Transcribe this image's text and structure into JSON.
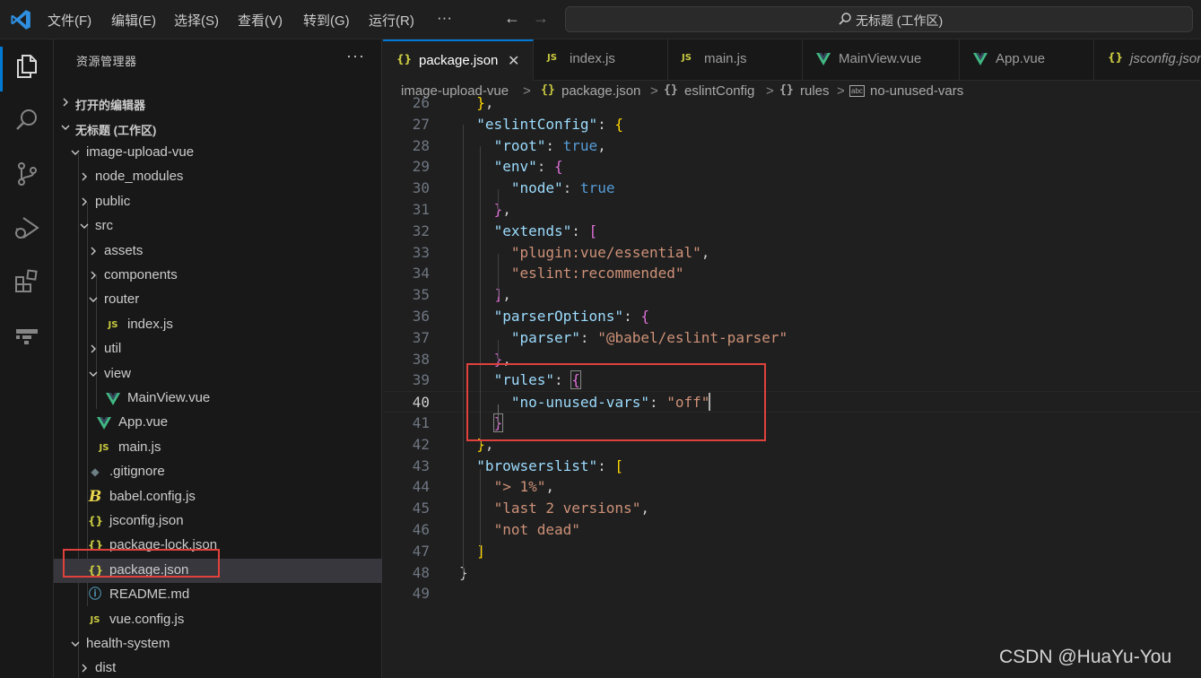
{
  "menu": {
    "items": [
      "文件(F)",
      "编辑(E)",
      "选择(S)",
      "查看(V)",
      "转到(G)",
      "运行(R)"
    ],
    "more": "···"
  },
  "navigation": {
    "back": "←",
    "forward": "→"
  },
  "command_center": {
    "label": "无标题 (工作区)"
  },
  "explorer": {
    "title": "资源管理器",
    "more": "···",
    "open_editors": "打开的编辑器",
    "workspace": "无标题 (工作区)",
    "tree": [
      {
        "label": "image-upload-vue",
        "kind": "folder-open"
      },
      {
        "label": "node_modules",
        "kind": "folder"
      },
      {
        "label": "public",
        "kind": "folder"
      },
      {
        "label": "src",
        "kind": "folder-open"
      },
      {
        "label": "assets",
        "kind": "folder"
      },
      {
        "label": "components",
        "kind": "folder"
      },
      {
        "label": "router",
        "kind": "folder-open"
      },
      {
        "label": "index.js",
        "kind": "js"
      },
      {
        "label": "util",
        "kind": "folder"
      },
      {
        "label": "view",
        "kind": "folder-open"
      },
      {
        "label": "MainView.vue",
        "kind": "vue"
      },
      {
        "label": "App.vue",
        "kind": "vue"
      },
      {
        "label": "main.js",
        "kind": "js"
      },
      {
        "label": ".gitignore",
        "kind": "git"
      },
      {
        "label": "babel.config.js",
        "kind": "babel"
      },
      {
        "label": "jsconfig.json",
        "kind": "json"
      },
      {
        "label": "package-lock.json",
        "kind": "json"
      },
      {
        "label": "package.json",
        "kind": "json"
      },
      {
        "label": "README.md",
        "kind": "info"
      },
      {
        "label": "vue.config.js",
        "kind": "js"
      },
      {
        "label": "health-system",
        "kind": "folder-open"
      },
      {
        "label": "dist",
        "kind": "folder"
      }
    ]
  },
  "icons": {
    "js": "JS",
    "json": "{}",
    "git": "◆",
    "babel": "B",
    "info": "ⓘ",
    "breadcrumb_braces": "{}",
    "breadcrumb_string": "abc"
  },
  "tabs": [
    {
      "label": "package.json",
      "kind": "json",
      "active": true,
      "close": "✕"
    },
    {
      "label": "index.js",
      "kind": "js"
    },
    {
      "label": "main.js",
      "kind": "js"
    },
    {
      "label": "MainView.vue",
      "kind": "vue"
    },
    {
      "label": "App.vue",
      "kind": "vue"
    },
    {
      "label": "jsconfig.json",
      "kind": "json"
    }
  ],
  "breadcrumbs": [
    "image-upload-vue",
    "package.json",
    "eslintConfig",
    "rules",
    "no-unused-vars"
  ],
  "breadcrumb_sep": ">",
  "editor": {
    "lines": [
      {
        "n": "26",
        "code": "  },"
      },
      {
        "n": "27",
        "code": "  \"eslintConfig\": {"
      },
      {
        "n": "28",
        "code": "    \"root\": true,"
      },
      {
        "n": "29",
        "code": "    \"env\": {"
      },
      {
        "n": "30",
        "code": "      \"node\": true"
      },
      {
        "n": "31",
        "code": "    },"
      },
      {
        "n": "32",
        "code": "    \"extends\": ["
      },
      {
        "n": "33",
        "code": "      \"plugin:vue/essential\","
      },
      {
        "n": "34",
        "code": "      \"eslint:recommended\""
      },
      {
        "n": "35",
        "code": "    ],"
      },
      {
        "n": "36",
        "code": "    \"parserOptions\": {"
      },
      {
        "n": "37",
        "code": "      \"parser\": \"@babel/eslint-parser\""
      },
      {
        "n": "38",
        "code": "    },"
      },
      {
        "n": "39",
        "code": "    \"rules\": {"
      },
      {
        "n": "40",
        "code": "      \"no-unused-vars\": \"off\""
      },
      {
        "n": "41",
        "code": "    }"
      },
      {
        "n": "42",
        "code": "  },"
      },
      {
        "n": "43",
        "code": "  \"browserslist\": ["
      },
      {
        "n": "44",
        "code": "    \"> 1%\","
      },
      {
        "n": "45",
        "code": "    \"last 2 versions\","
      },
      {
        "n": "46",
        "code": "    \"not dead\""
      },
      {
        "n": "47",
        "code": "  ]"
      },
      {
        "n": "48",
        "code": "}"
      },
      {
        "n": "49",
        "code": ""
      }
    ],
    "current_line": "40"
  },
  "watermark": "CSDN @HuaYu-You",
  "colors": {
    "accent": "#0078d4",
    "highlight_box": "#e0413c",
    "json_key": "#9cdcfe",
    "json_string": "#ce9178",
    "json_bool": "#569cd6"
  }
}
